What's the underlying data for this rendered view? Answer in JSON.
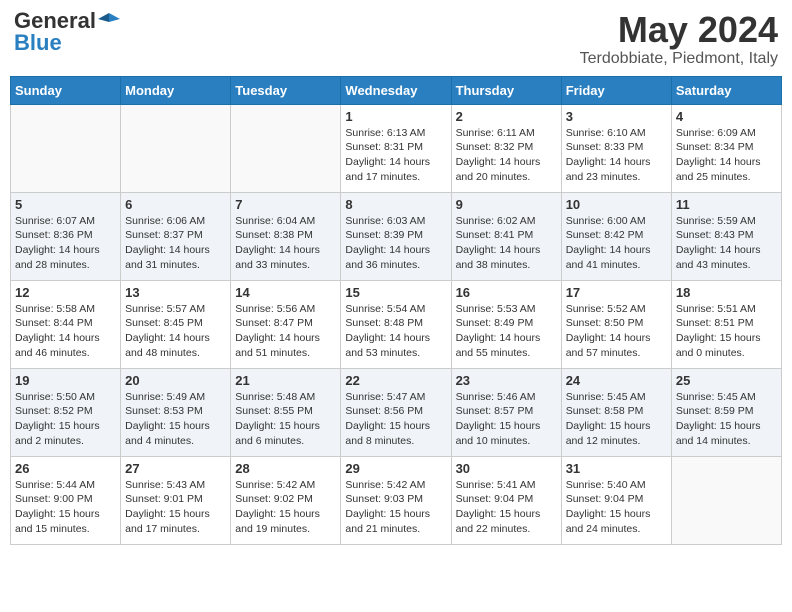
{
  "header": {
    "logo_general": "General",
    "logo_blue": "Blue",
    "month_year": "May 2024",
    "location": "Terdobbiate, Piedmont, Italy"
  },
  "days_of_week": [
    "Sunday",
    "Monday",
    "Tuesday",
    "Wednesday",
    "Thursday",
    "Friday",
    "Saturday"
  ],
  "weeks": [
    [
      {
        "day": "",
        "info": ""
      },
      {
        "day": "",
        "info": ""
      },
      {
        "day": "",
        "info": ""
      },
      {
        "day": "1",
        "info": "Sunrise: 6:13 AM\nSunset: 8:31 PM\nDaylight: 14 hours\nand 17 minutes."
      },
      {
        "day": "2",
        "info": "Sunrise: 6:11 AM\nSunset: 8:32 PM\nDaylight: 14 hours\nand 20 minutes."
      },
      {
        "day": "3",
        "info": "Sunrise: 6:10 AM\nSunset: 8:33 PM\nDaylight: 14 hours\nand 23 minutes."
      },
      {
        "day": "4",
        "info": "Sunrise: 6:09 AM\nSunset: 8:34 PM\nDaylight: 14 hours\nand 25 minutes."
      }
    ],
    [
      {
        "day": "5",
        "info": "Sunrise: 6:07 AM\nSunset: 8:36 PM\nDaylight: 14 hours\nand 28 minutes."
      },
      {
        "day": "6",
        "info": "Sunrise: 6:06 AM\nSunset: 8:37 PM\nDaylight: 14 hours\nand 31 minutes."
      },
      {
        "day": "7",
        "info": "Sunrise: 6:04 AM\nSunset: 8:38 PM\nDaylight: 14 hours\nand 33 minutes."
      },
      {
        "day": "8",
        "info": "Sunrise: 6:03 AM\nSunset: 8:39 PM\nDaylight: 14 hours\nand 36 minutes."
      },
      {
        "day": "9",
        "info": "Sunrise: 6:02 AM\nSunset: 8:41 PM\nDaylight: 14 hours\nand 38 minutes."
      },
      {
        "day": "10",
        "info": "Sunrise: 6:00 AM\nSunset: 8:42 PM\nDaylight: 14 hours\nand 41 minutes."
      },
      {
        "day": "11",
        "info": "Sunrise: 5:59 AM\nSunset: 8:43 PM\nDaylight: 14 hours\nand 43 minutes."
      }
    ],
    [
      {
        "day": "12",
        "info": "Sunrise: 5:58 AM\nSunset: 8:44 PM\nDaylight: 14 hours\nand 46 minutes."
      },
      {
        "day": "13",
        "info": "Sunrise: 5:57 AM\nSunset: 8:45 PM\nDaylight: 14 hours\nand 48 minutes."
      },
      {
        "day": "14",
        "info": "Sunrise: 5:56 AM\nSunset: 8:47 PM\nDaylight: 14 hours\nand 51 minutes."
      },
      {
        "day": "15",
        "info": "Sunrise: 5:54 AM\nSunset: 8:48 PM\nDaylight: 14 hours\nand 53 minutes."
      },
      {
        "day": "16",
        "info": "Sunrise: 5:53 AM\nSunset: 8:49 PM\nDaylight: 14 hours\nand 55 minutes."
      },
      {
        "day": "17",
        "info": "Sunrise: 5:52 AM\nSunset: 8:50 PM\nDaylight: 14 hours\nand 57 minutes."
      },
      {
        "day": "18",
        "info": "Sunrise: 5:51 AM\nSunset: 8:51 PM\nDaylight: 15 hours\nand 0 minutes."
      }
    ],
    [
      {
        "day": "19",
        "info": "Sunrise: 5:50 AM\nSunset: 8:52 PM\nDaylight: 15 hours\nand 2 minutes."
      },
      {
        "day": "20",
        "info": "Sunrise: 5:49 AM\nSunset: 8:53 PM\nDaylight: 15 hours\nand 4 minutes."
      },
      {
        "day": "21",
        "info": "Sunrise: 5:48 AM\nSunset: 8:55 PM\nDaylight: 15 hours\nand 6 minutes."
      },
      {
        "day": "22",
        "info": "Sunrise: 5:47 AM\nSunset: 8:56 PM\nDaylight: 15 hours\nand 8 minutes."
      },
      {
        "day": "23",
        "info": "Sunrise: 5:46 AM\nSunset: 8:57 PM\nDaylight: 15 hours\nand 10 minutes."
      },
      {
        "day": "24",
        "info": "Sunrise: 5:45 AM\nSunset: 8:58 PM\nDaylight: 15 hours\nand 12 minutes."
      },
      {
        "day": "25",
        "info": "Sunrise: 5:45 AM\nSunset: 8:59 PM\nDaylight: 15 hours\nand 14 minutes."
      }
    ],
    [
      {
        "day": "26",
        "info": "Sunrise: 5:44 AM\nSunset: 9:00 PM\nDaylight: 15 hours\nand 15 minutes."
      },
      {
        "day": "27",
        "info": "Sunrise: 5:43 AM\nSunset: 9:01 PM\nDaylight: 15 hours\nand 17 minutes."
      },
      {
        "day": "28",
        "info": "Sunrise: 5:42 AM\nSunset: 9:02 PM\nDaylight: 15 hours\nand 19 minutes."
      },
      {
        "day": "29",
        "info": "Sunrise: 5:42 AM\nSunset: 9:03 PM\nDaylight: 15 hours\nand 21 minutes."
      },
      {
        "day": "30",
        "info": "Sunrise: 5:41 AM\nSunset: 9:04 PM\nDaylight: 15 hours\nand 22 minutes."
      },
      {
        "day": "31",
        "info": "Sunrise: 5:40 AM\nSunset: 9:04 PM\nDaylight: 15 hours\nand 24 minutes."
      },
      {
        "day": "",
        "info": ""
      }
    ]
  ]
}
